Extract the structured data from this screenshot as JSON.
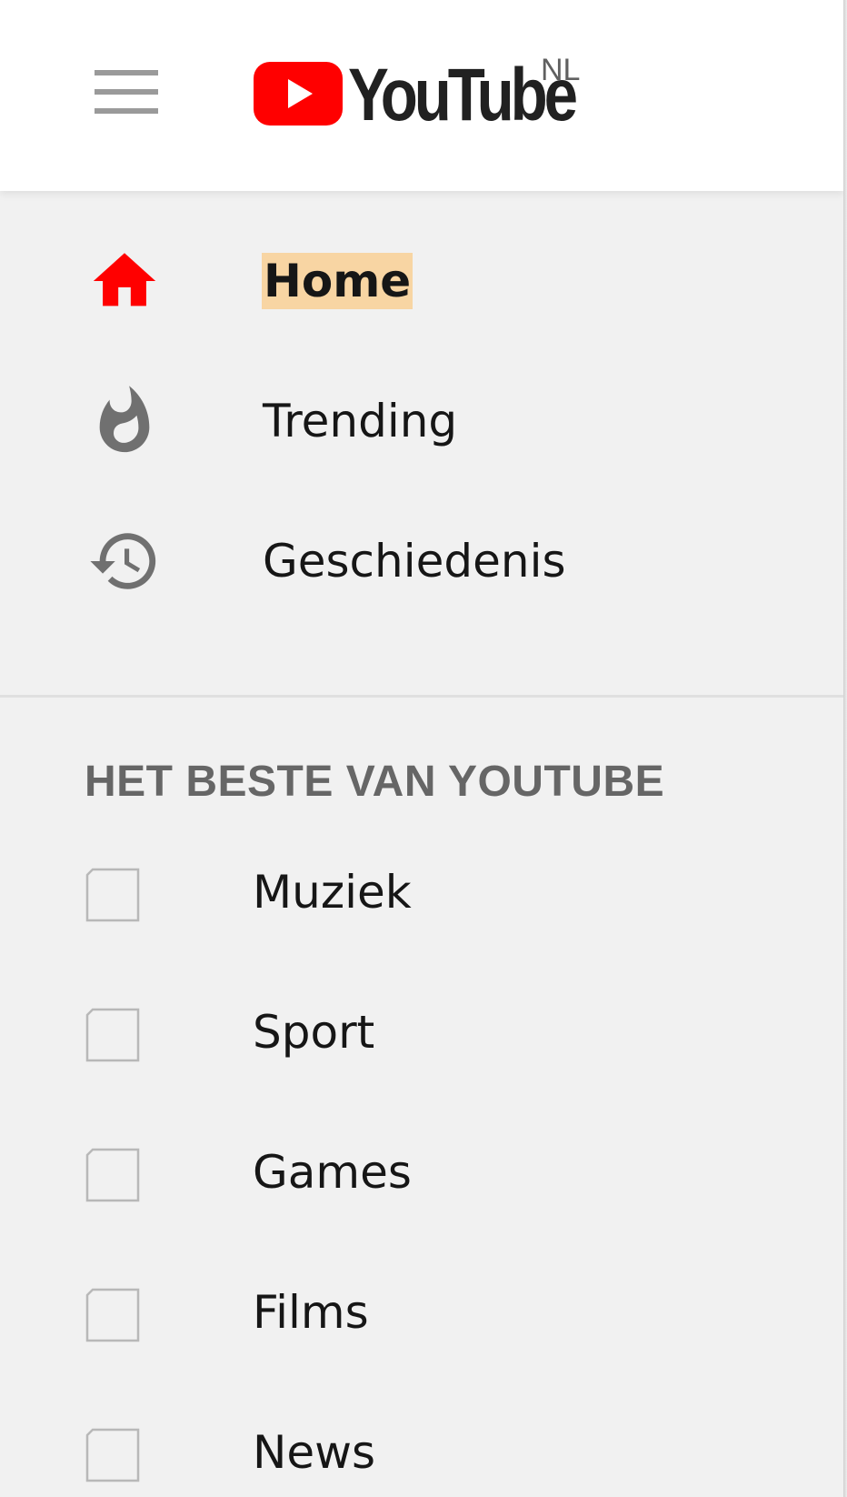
{
  "header": {
    "menu_icon": "hamburger-menu-icon",
    "logo_text": "YouTube",
    "region": "NL",
    "brand_color": "#ff0000"
  },
  "nav": {
    "items": [
      {
        "label": "Home",
        "icon": "home-icon",
        "active": true
      },
      {
        "label": "Trending",
        "icon": "flame-icon",
        "active": false
      },
      {
        "label": "Geschiedenis",
        "icon": "history-icon",
        "active": false
      }
    ]
  },
  "section": {
    "title": "HET BESTE VAN YOUTUBE",
    "items": [
      {
        "label": "Muziek",
        "icon": "channel-thumbnail-icon"
      },
      {
        "label": "Sport",
        "icon": "channel-thumbnail-icon"
      },
      {
        "label": "Games",
        "icon": "channel-thumbnail-icon"
      },
      {
        "label": "Films",
        "icon": "channel-thumbnail-icon"
      },
      {
        "label": "News",
        "icon": "channel-thumbnail-icon"
      }
    ]
  }
}
